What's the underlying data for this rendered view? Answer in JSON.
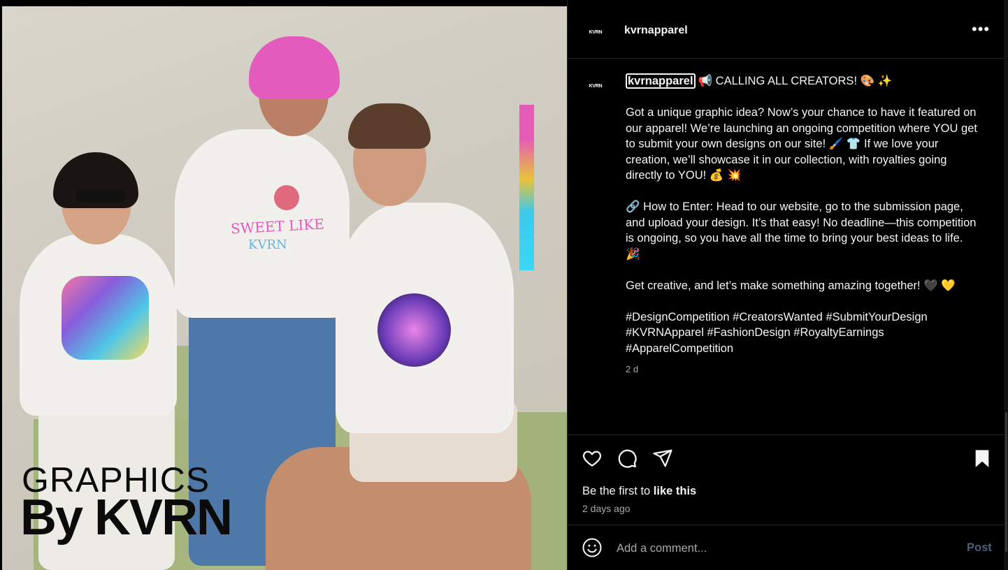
{
  "media": {
    "brand_line1": "GRAPHICS",
    "brand_line2": "By KVRN",
    "shirt_text1": "SWEET LIKE",
    "shirt_text2": "KVRN"
  },
  "header": {
    "avatar_text": "KVRN",
    "username": "kvrnapparel",
    "more_label": "•••"
  },
  "caption": {
    "avatar_text": "KVRN",
    "username": "kvrnapparel",
    "intro": "📢 CALLING ALL CREATORS! 🎨 ✨",
    "paragraph1": "Got a unique graphic idea? Now’s your chance to have it featured on our apparel! We’re launching an ongoing competition where YOU get to submit your own designs on our site! 🖌️ 👕 If we love your creation, we’ll showcase it in our collection, with royalties going directly to YOU! 💰 💥",
    "paragraph2": "🔗 How to Enter: Head to our website, go to the submission page, and upload your design. It’s that easy! No deadline—this competition is ongoing, so you have all the time to bring your best ideas to life. 🎉",
    "paragraph3": "Get creative, and let’s make something amazing together! 🖤 💛",
    "hashtags": "#DesignCompetition #CreatorsWanted #SubmitYourDesign #KVRNApparel #FashionDesign #RoyaltyEarnings #ApparelCompetition",
    "time": "2 d"
  },
  "actions": {
    "likes_prefix": "Be the first to ",
    "likes_link": "like this",
    "posted_ago": "2 days ago"
  },
  "comment": {
    "placeholder": "Add a comment...",
    "post_label": "Post"
  },
  "icons": [
    "heart-icon",
    "comment-icon",
    "share-icon",
    "bookmark-icon",
    "emoji-icon",
    "more-icon"
  ],
  "colors": {
    "background": "#000000",
    "text": "#f5f5f5",
    "muted": "#a8a8a8",
    "divider": "#262626",
    "post_disabled": "#4f5f7a"
  }
}
